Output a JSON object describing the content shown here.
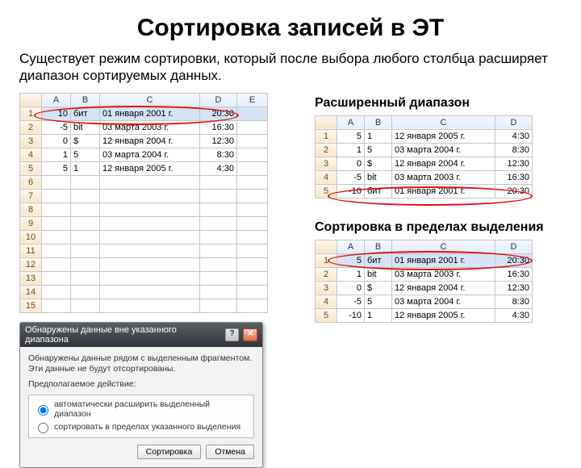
{
  "title": "Сортировка записей в ЭТ",
  "description": "Существует режим сортировки, который после выбора любого столбца расширяет диапазон сортируемых данных.",
  "labels": {
    "expanded": "Расширенный диапазон",
    "within_selection": "Сортировка в пределах выделения"
  },
  "columns": [
    "A",
    "B",
    "C",
    "D"
  ],
  "sheet_left": {
    "columns": [
      "A",
      "B",
      "C",
      "D",
      "E"
    ],
    "rows": [
      {
        "n": "1",
        "A": "10",
        "B": "бит",
        "C": "01 января 2001 г.",
        "D": "20:30",
        "sel": true
      },
      {
        "n": "2",
        "A": "-5",
        "B": "bit",
        "C": "03 марта 2003 г.",
        "D": "16:30"
      },
      {
        "n": "3",
        "A": "0",
        "B": "$",
        "C": "12 января 2004 г.",
        "D": "12:30"
      },
      {
        "n": "4",
        "A": "1",
        "B": "5",
        "C": "03 марта 2004 г.",
        "D": "8:30"
      },
      {
        "n": "5",
        "A": "5",
        "B": "1",
        "C": "12 января 2005 г.",
        "D": "4:30"
      },
      {
        "n": "6"
      },
      {
        "n": "7"
      },
      {
        "n": "8"
      },
      {
        "n": "9"
      },
      {
        "n": "10"
      },
      {
        "n": "11"
      },
      {
        "n": "12"
      },
      {
        "n": "13"
      },
      {
        "n": "14"
      },
      {
        "n": "15"
      }
    ]
  },
  "sheet_expanded": {
    "rows": [
      {
        "n": "1",
        "A": "5",
        "B": "1",
        "C": "12 января 2005 г.",
        "D": "4:30"
      },
      {
        "n": "2",
        "A": "1",
        "B": "5",
        "C": "03 марта 2004 г.",
        "D": "8:30"
      },
      {
        "n": "3",
        "A": "0",
        "B": "$",
        "C": "12 января 2004 г.",
        "D": "12:30"
      },
      {
        "n": "4",
        "A": "-5",
        "B": "bit",
        "C": "03 марта 2003 г.",
        "D": "16:30"
      },
      {
        "n": "5",
        "A": "-10",
        "B": "бит",
        "C": "01 января 2001 г.",
        "D": "20:30"
      }
    ]
  },
  "sheet_selection": {
    "rows": [
      {
        "n": "1",
        "A": "5",
        "B": "бит",
        "C": "01 января 2001 г.",
        "D": "20:30",
        "sel": true
      },
      {
        "n": "2",
        "A": "1",
        "B": "bit",
        "C": "03 марта 2003 г.",
        "D": "16:30"
      },
      {
        "n": "3",
        "A": "0",
        "B": "$",
        "C": "12 января 2004 г.",
        "D": "12:30"
      },
      {
        "n": "4",
        "A": "-5",
        "B": "5",
        "C": "03 марта 2004 г.",
        "D": "8:30"
      },
      {
        "n": "5",
        "A": "-10",
        "B": "1",
        "C": "12 января 2005 г.",
        "D": "4:30"
      }
    ]
  },
  "dialog": {
    "title": "Обнаружены данные вне указанного диапазона",
    "message": "Обнаружены данные рядом с выделенным фрагментом. Эти данные не будут отсортированы.",
    "prompt": "Предполагаемое действие:",
    "opt1": "автоматически расширить выделенный диапазон",
    "opt2": "сортировать в пределах указанного выделения",
    "ok": "Сортировка",
    "cancel": "Отмена"
  }
}
